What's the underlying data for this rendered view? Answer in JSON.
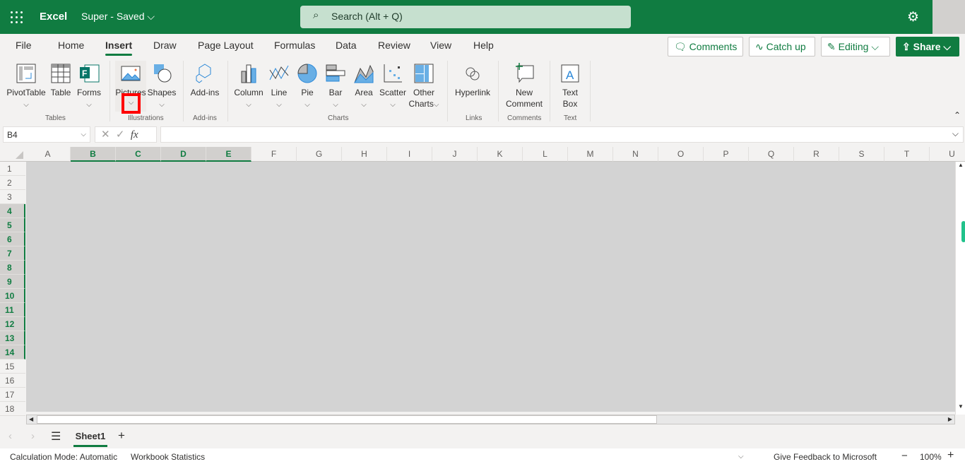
{
  "app": {
    "name": "Excel",
    "doc_title": "Super",
    "save_status": "Saved",
    "search_placeholder": "Search (Alt + Q)"
  },
  "tabs": [
    {
      "label": "File"
    },
    {
      "label": "Home"
    },
    {
      "label": "Insert",
      "active": true
    },
    {
      "label": "Draw"
    },
    {
      "label": "Page Layout"
    },
    {
      "label": "Formulas"
    },
    {
      "label": "Data"
    },
    {
      "label": "Review"
    },
    {
      "label": "View"
    },
    {
      "label": "Help"
    }
  ],
  "header_buttons": {
    "comments": "Comments",
    "catch_up": "Catch up",
    "editing": "Editing",
    "share": "Share"
  },
  "ribbon": {
    "groups": {
      "tables": "Tables",
      "illustrations": "Illustrations",
      "addins": "Add-ins",
      "charts": "Charts",
      "links": "Links",
      "comments": "Comments",
      "text": "Text"
    },
    "items": {
      "pivottable": "PivotTable",
      "table": "Table",
      "forms": "Forms",
      "pictures": "Pictures",
      "shapes": "Shapes",
      "addins": "Add-ins",
      "column": "Column",
      "line": "Line",
      "pie": "Pie",
      "bar": "Bar",
      "area": "Area",
      "scatter": "Scatter",
      "other1": "Other",
      "other2": "Charts",
      "hyperlink": "Hyperlink",
      "newcomment1": "New",
      "newcomment2": "Comment",
      "textbox1": "Text",
      "textbox2": "Box"
    }
  },
  "formula_bar": {
    "name_box": "B4",
    "fx": "fx",
    "value": ""
  },
  "columns": [
    "A",
    "B",
    "C",
    "D",
    "E",
    "F",
    "G",
    "H",
    "I",
    "J",
    "K",
    "L",
    "M",
    "N",
    "O",
    "P",
    "Q",
    "R",
    "S",
    "T",
    "U"
  ],
  "selected_columns": [
    "B",
    "C",
    "D",
    "E"
  ],
  "rows": [
    1,
    2,
    3,
    4,
    5,
    6,
    7,
    8,
    9,
    10,
    11,
    12,
    13,
    14,
    15,
    16,
    17,
    18
  ],
  "selected_rows": [
    4,
    5,
    6,
    7,
    8,
    9,
    10,
    11,
    12,
    13,
    14
  ],
  "sheets": [
    {
      "name": "Sheet1",
      "active": true
    }
  ],
  "status": {
    "calc_mode": "Calculation Mode: Automatic",
    "stats": "Workbook Statistics",
    "feedback": "Give Feedback to Microsoft",
    "zoom": "100%"
  },
  "colors": {
    "brand": "#107c41",
    "highlight": "#ff0000"
  }
}
